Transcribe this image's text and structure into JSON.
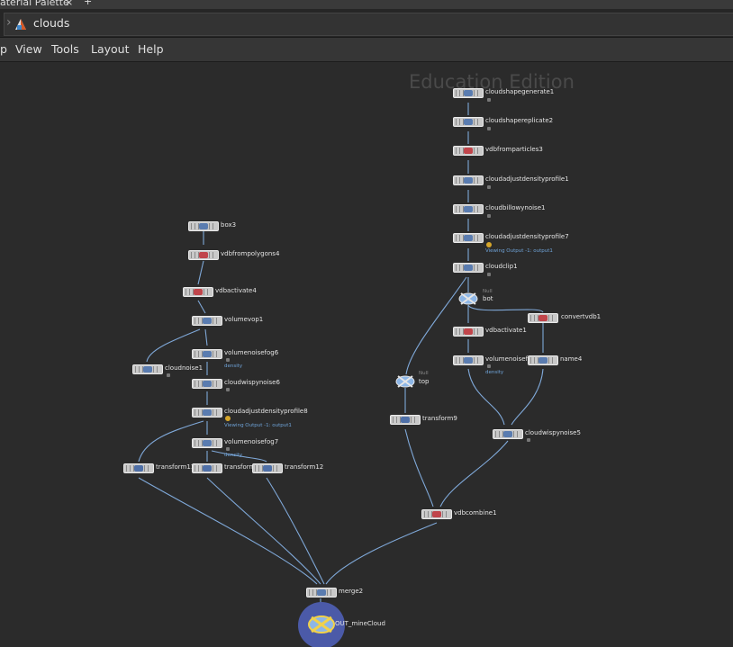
{
  "tabstrip": {
    "tab_label": "aterial Palette",
    "close": "×",
    "add": "+"
  },
  "path": {
    "crumb": "clouds"
  },
  "menu": {
    "items": [
      "p",
      "View",
      "Tools",
      "Layout",
      "Help"
    ]
  },
  "watermark": "Education Edition",
  "nodes": {
    "cloudshapegenerate1": "cloudshapegenerate1",
    "cloudshapereplicate2": "cloudshapereplicate2",
    "vdbfromparticles3": "vdbfromparticles3",
    "cloudadjustdensityprofile1": "cloudadjustdensityprofile1",
    "cloudbillowynoise1": "cloudbillowynoise1",
    "cloudadjustdensityprofile7": "cloudadjustdensityprofile7",
    "cloudclip1": "cloudclip1",
    "bot": "bot",
    "convertvdb1": "convertvdb1",
    "vdbactivate1": "vdbactivate1",
    "volumenoisefog": "volumenoisefog",
    "name4": "name4",
    "top": "top",
    "transform9": "transform9",
    "cloudwispynoise5": "cloudwispynoise5",
    "vdbcombine1": "vdbcombine1",
    "box3": "box3",
    "vdbfrompolygons4": "vdbfrompolygons4",
    "vdbactivate4": "vdbactivate4",
    "volumevop1": "volumevop1",
    "volumenoisefog6": "volumenoisefog6",
    "cloudnoise1": "cloudnoise1",
    "cloudwispynoise6": "cloudwispynoise6",
    "cloudadjustdensityprofile8": "cloudadjustdensityprofile8",
    "volumenoisefog7": "volumenoisefog7",
    "transform11": "transform11",
    "transform": "transform",
    "transform12": "transform12",
    "merge2": "merge2",
    "out": "OUT_mineCloud"
  },
  "subs": {
    "viewing_output_7": "Viewing Output -1: output1",
    "viewing_output_8": "Viewing Output -1: output1",
    "density_fog": "density",
    "density_fog6": "density",
    "density_fog7": "density",
    "null_bot": "Null",
    "null_top": "Null"
  }
}
